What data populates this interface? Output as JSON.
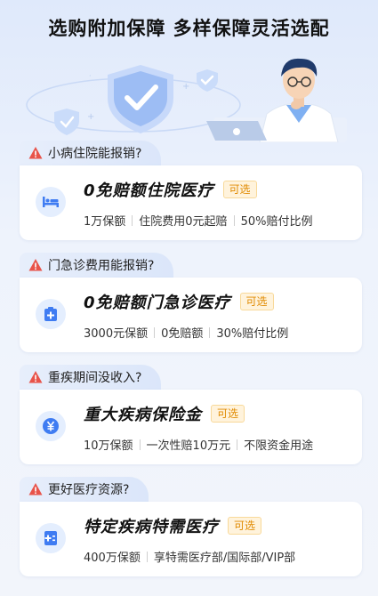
{
  "headline": "选购附加保障  多样保障灵活选配",
  "sections": [
    {
      "question": "小病住院能报销?",
      "icon": "bed-icon",
      "title": "0免赔额住院医疗",
      "badge": "可选",
      "desc": [
        "1万保额",
        "住院费用0元起赔",
        "50%赔付比例"
      ]
    },
    {
      "question": "门急诊费用能报销?",
      "icon": "clinic-icon",
      "title": "0免赔额门急诊医疗",
      "badge": "可选",
      "desc": [
        "3000元保额",
        "0免赔额",
        "30%赔付比例"
      ]
    },
    {
      "question": "重疾期间没收入?",
      "icon": "yen-icon",
      "title": "重大疾病保险金",
      "badge": "可选",
      "desc": [
        "10万保额",
        "一次性赔10万元",
        "不限资金用途"
      ]
    },
    {
      "question": "更好医疗资源?",
      "icon": "medical-file-icon",
      "title": "特定疾病特需医疗",
      "badge": "可选",
      "desc": [
        "400万保额",
        "享特需医疗部/国际部/VIP部"
      ]
    }
  ],
  "colors": {
    "accent": "#3f7cf2",
    "warning": "#e8534a",
    "badge_text": "#e08a00"
  }
}
